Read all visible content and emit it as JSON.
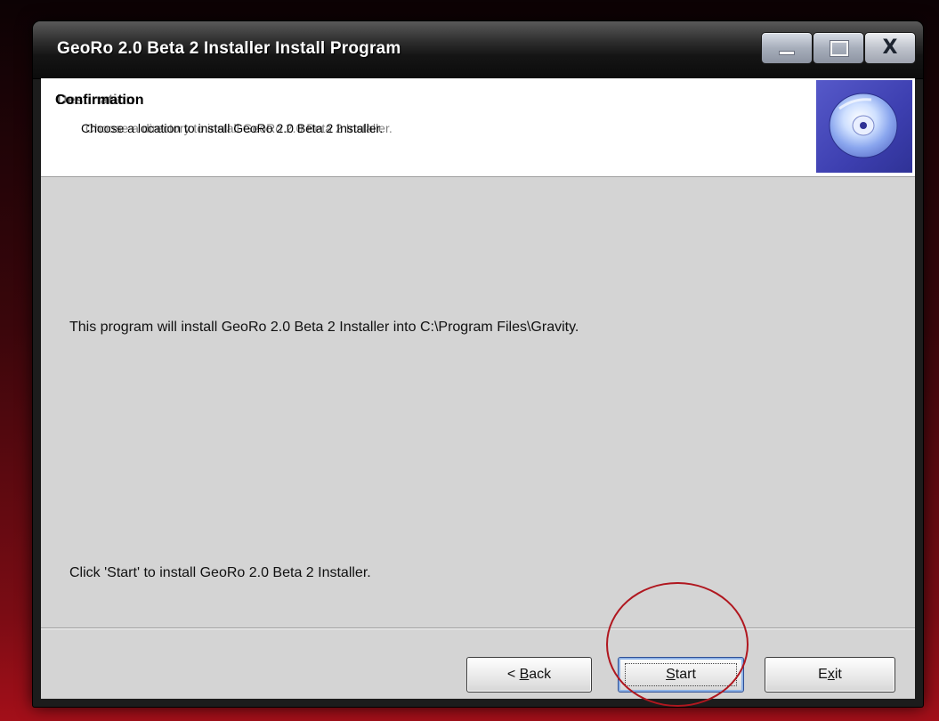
{
  "window": {
    "title": "GeoRo 2.0 Beta 2 Installer Install Program",
    "controls": {
      "minimize_icon": "minimize-icon",
      "maximize_icon": "maximize-icon",
      "close_glyph": "X"
    }
  },
  "header": {
    "title": "Confirmation",
    "title_overlap": "Destination",
    "subtitle": "Choose a location to install GeoRo 2.0 Beta 2 Installer.",
    "subtitle_overlap": "Choose a directory to install GeoRo 2.0 Beta 2 Installer.",
    "icon": "cd-disc-icon"
  },
  "body": {
    "install_path_message": "This program will install GeoRo 2.0 Beta 2 Installer into C:\\Program Files\\Gravity.",
    "click_start_message": "Click 'Start' to install GeoRo 2.0 Beta 2 Installer."
  },
  "buttons": {
    "back": {
      "prefix": "< ",
      "mnemonic": "B",
      "rest": "ack"
    },
    "start": {
      "prefix": "",
      "mnemonic": "S",
      "rest": "tart"
    },
    "exit": {
      "prefix": "E",
      "mnemonic": "x",
      "rest": "it"
    }
  },
  "annotation": {
    "highlight_color": "#b0171f",
    "highlighted_element": "start-button"
  },
  "colors": {
    "backdrop_red": "#a30f19",
    "titlebar": "#151515",
    "dialog_body": "#d4d4d4",
    "cd_box": "#3d3fb0"
  }
}
